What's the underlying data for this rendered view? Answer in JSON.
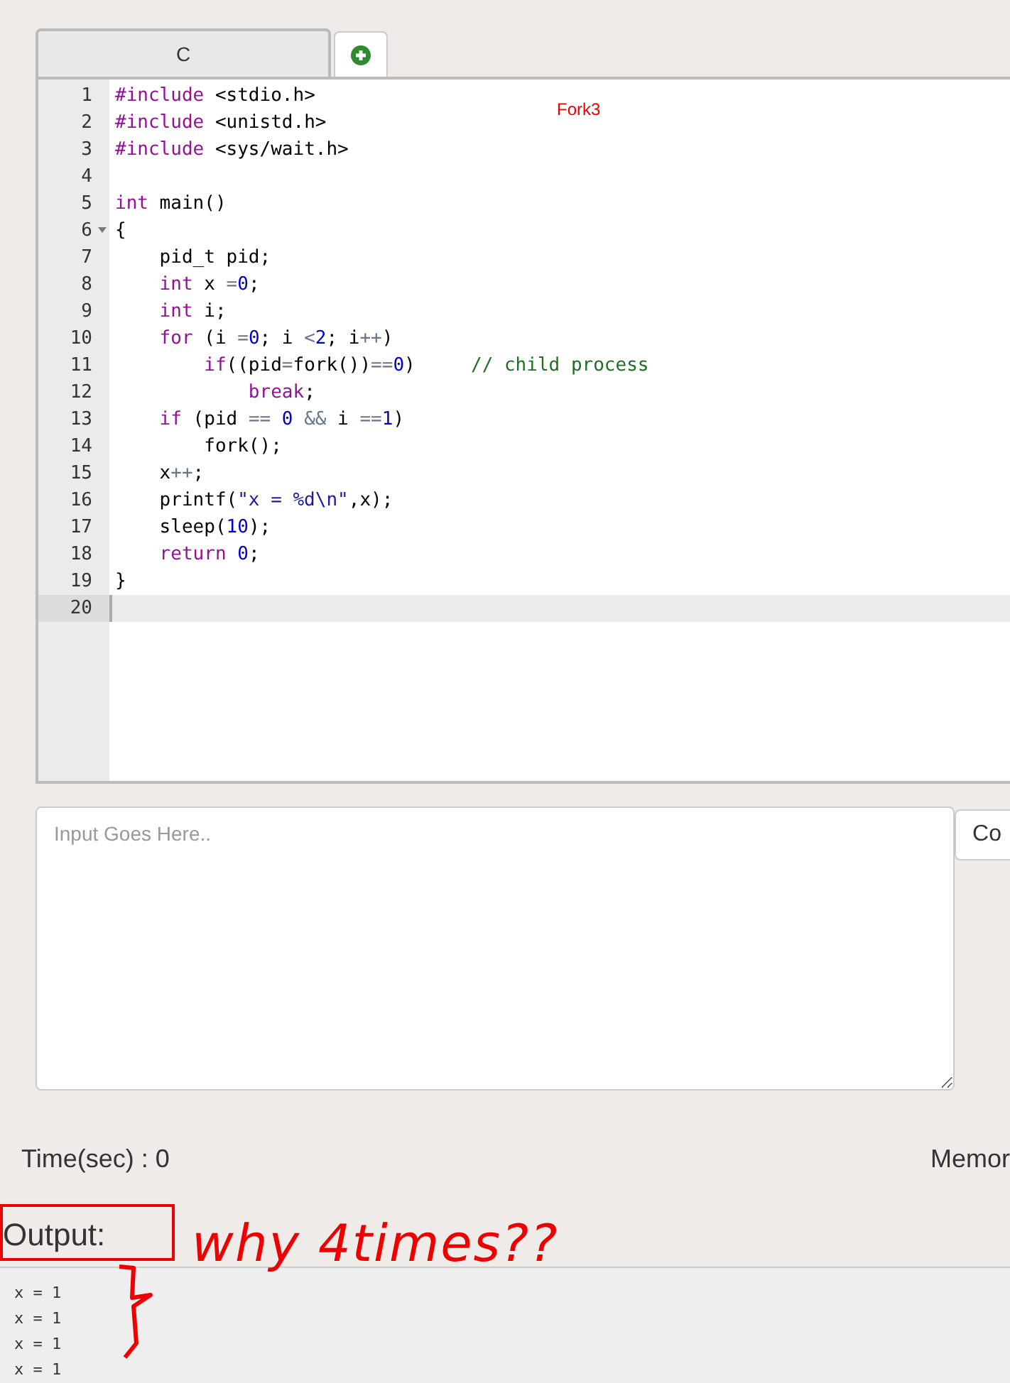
{
  "tabs": [
    {
      "label": "C",
      "kind": "text",
      "selected": true
    },
    {
      "kind": "add",
      "selected": false
    }
  ],
  "editor": {
    "title_note": "Fork3",
    "lines": [
      {
        "number": "1",
        "active": false,
        "tokens": [
          {
            "kind": "kw",
            "text": "#include"
          },
          {
            "kind": "plain",
            "text": " <stdio.h>"
          }
        ]
      },
      {
        "number": "2",
        "active": false,
        "tokens": [
          {
            "kind": "kw",
            "text": "#include"
          },
          {
            "kind": "plain",
            "text": " <unistd.h>"
          }
        ]
      },
      {
        "number": "3",
        "active": false,
        "tokens": [
          {
            "kind": "kw",
            "text": "#include"
          },
          {
            "kind": "plain",
            "text": " <sys/wait.h>"
          }
        ]
      },
      {
        "number": "4",
        "active": false
      },
      {
        "number": "5",
        "active": false,
        "tokens": [
          {
            "kind": "kw",
            "text": "int"
          },
          {
            "kind": "plain",
            "text": " main()"
          }
        ]
      },
      {
        "number": "6",
        "active": false,
        "fold": true,
        "tokens": [
          {
            "kind": "plain",
            "text": "{"
          }
        ]
      },
      {
        "number": "7",
        "active": false,
        "tokens": [
          {
            "kind": "plain",
            "text": "    pid_t pid;"
          }
        ]
      },
      {
        "number": "8",
        "active": false,
        "tokens": [
          {
            "kind": "kw",
            "text": "    int"
          },
          {
            "kind": "plain",
            "text": " x "
          },
          {
            "kind": "op",
            "text": "="
          },
          {
            "kind": "num",
            "text": "0"
          },
          {
            "kind": "plain",
            "text": ";"
          }
        ]
      },
      {
        "number": "9",
        "active": false,
        "tokens": [
          {
            "kind": "kw",
            "text": "    int"
          },
          {
            "kind": "plain",
            "text": " i;"
          }
        ]
      },
      {
        "number": "10",
        "active": false,
        "tokens": [
          {
            "kind": "kw",
            "text": "    for"
          },
          {
            "kind": "plain",
            "text": " (i "
          },
          {
            "kind": "op",
            "text": "="
          },
          {
            "kind": "num",
            "text": "0"
          },
          {
            "kind": "plain",
            "text": "; i "
          },
          {
            "kind": "op",
            "text": "<"
          },
          {
            "kind": "num",
            "text": "2"
          },
          {
            "kind": "plain",
            "text": "; i"
          },
          {
            "kind": "op",
            "text": "++"
          },
          {
            "kind": "plain",
            "text": ")"
          }
        ]
      },
      {
        "number": "11",
        "active": false,
        "tokens": [
          {
            "kind": "kw",
            "text": "        if"
          },
          {
            "kind": "plain",
            "text": "((pid"
          },
          {
            "kind": "op",
            "text": "="
          },
          {
            "kind": "plain",
            "text": "fork())"
          },
          {
            "kind": "op",
            "text": "=="
          },
          {
            "kind": "num",
            "text": "0"
          },
          {
            "kind": "plain",
            "text": ")     "
          },
          {
            "kind": "comment",
            "text": "// child process"
          }
        ]
      },
      {
        "number": "12",
        "active": false,
        "tokens": [
          {
            "kind": "kw",
            "text": "            break"
          },
          {
            "kind": "plain",
            "text": ";"
          }
        ]
      },
      {
        "number": "13",
        "active": false,
        "tokens": [
          {
            "kind": "kw",
            "text": "    if"
          },
          {
            "kind": "plain",
            "text": " (pid "
          },
          {
            "kind": "op",
            "text": "=="
          },
          {
            "kind": "num",
            "text": " 0"
          },
          {
            "kind": "op",
            "text": " &&"
          },
          {
            "kind": "plain",
            "text": " i "
          },
          {
            "kind": "op",
            "text": "=="
          },
          {
            "kind": "num",
            "text": "1"
          },
          {
            "kind": "plain",
            "text": ")"
          }
        ]
      },
      {
        "number": "14",
        "active": false,
        "tokens": [
          {
            "kind": "plain",
            "text": "        fork();"
          }
        ]
      },
      {
        "number": "15",
        "active": false,
        "tokens": [
          {
            "kind": "plain",
            "text": "    x"
          },
          {
            "kind": "op",
            "text": "++"
          },
          {
            "kind": "plain",
            "text": ";"
          }
        ]
      },
      {
        "number": "16",
        "active": false,
        "tokens": [
          {
            "kind": "plain",
            "text": "    printf("
          },
          {
            "kind": "str",
            "text": "\"x = %d\\n\""
          },
          {
            "kind": "plain",
            "text": ",x);"
          }
        ]
      },
      {
        "number": "17",
        "active": false,
        "tokens": [
          {
            "kind": "plain",
            "text": "    sleep("
          },
          {
            "kind": "num",
            "text": "10"
          },
          {
            "kind": "plain",
            "text": ");"
          }
        ]
      },
      {
        "number": "18",
        "active": false,
        "tokens": [
          {
            "kind": "kw",
            "text": "    return"
          },
          {
            "kind": "num",
            "text": " 0"
          },
          {
            "kind": "plain",
            "text": ";"
          }
        ]
      },
      {
        "number": "19",
        "active": false,
        "tokens": [
          {
            "kind": "plain",
            "text": "}"
          }
        ]
      },
      {
        "number": "20",
        "active": true
      }
    ]
  },
  "input": {
    "placeholder": "Input Goes Here.."
  },
  "side_button": "Co",
  "time": "Time(sec) : 0",
  "memory": "Memor",
  "output": {
    "label": "Output:",
    "lines": [
      "x = 1",
      "x = 1",
      "x = 1",
      "x = 1"
    ]
  },
  "annotation": {
    "text": "why 4times??"
  }
}
